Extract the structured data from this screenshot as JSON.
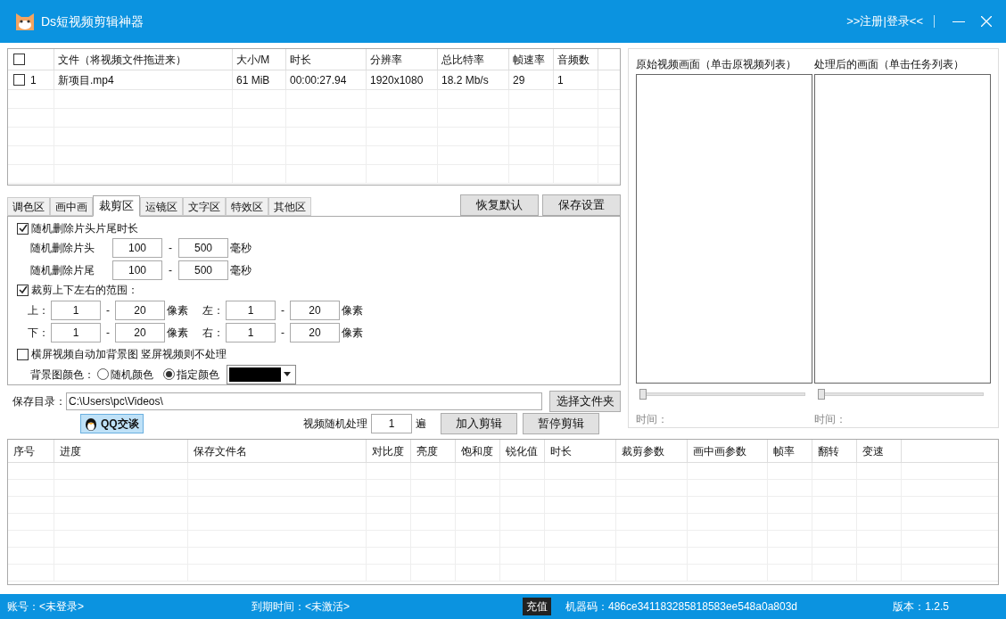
{
  "window": {
    "title": "Ds短视频剪辑神器",
    "register_link": ">>注册|登录<<"
  },
  "source_table": {
    "columns": [
      "文件（将视频文件拖进来）",
      "大小/M",
      "时长",
      "分辨率",
      "总比特率",
      "帧速率",
      "音频数"
    ],
    "header_checked": false,
    "rows": [
      {
        "checked": false,
        "index": "1",
        "cells": [
          "新项目.mp4",
          "61 MiB",
          "00:00:27.94",
          "1920x1080",
          "18.2 Mb/s",
          "29",
          "1"
        ]
      }
    ]
  },
  "tabs": [
    {
      "label": "调色区",
      "selected": false
    },
    {
      "label": "画中画",
      "selected": false
    },
    {
      "label": "裁剪区",
      "selected": true
    },
    {
      "label": "运镜区",
      "selected": false
    },
    {
      "label": "文字区",
      "selected": false
    },
    {
      "label": "特效区",
      "selected": false
    },
    {
      "label": "其他区",
      "selected": false
    }
  ],
  "tab_buttons": [
    "恢复默认",
    "保存设置"
  ],
  "trim": {
    "label": "随机删除片头片尾时长",
    "checked": true,
    "rows": [
      {
        "label": "随机删除片头",
        "from": "100",
        "separator": "-",
        "to": "500",
        "unit": "毫秒"
      },
      {
        "label": "随机删除片尾",
        "from": "100",
        "separator": "-",
        "to": "500",
        "unit": "毫秒"
      }
    ]
  },
  "crop": {
    "label": "裁剪上下左右的范围：",
    "checked": true,
    "rows": [
      [
        {
          "label": "上：",
          "from": "1",
          "separator": "-",
          "to": "20",
          "unit": "像素"
        },
        {
          "label": "左：",
          "from": "1",
          "separator": "-",
          "to": "20",
          "unit": "像素"
        }
      ],
      [
        {
          "label": "下：",
          "from": "1",
          "separator": "-",
          "to": "20",
          "unit": "像素"
        },
        {
          "label": "右：",
          "from": "1",
          "separator": "-",
          "to": "20",
          "unit": "像素"
        }
      ]
    ]
  },
  "background": {
    "label": "横屏视频自动加背景图 竖屏视频则不处理",
    "checked": false,
    "color_label": "背景图颜色：",
    "options": [
      {
        "label": "随机颜色",
        "selected": false
      },
      {
        "label": "指定颜色",
        "selected": true
      }
    ]
  },
  "save_dir": {
    "label": "保存目录：",
    "value": "C:\\Users\\pc\\Videos\\",
    "button": "选择文件夹"
  },
  "qq_button": "QQ交谈",
  "random_process": {
    "label": "视频随机处理",
    "value": "1",
    "unit": "遍"
  },
  "action_buttons": [
    "加入剪辑",
    "暂停剪辑"
  ],
  "previews": [
    {
      "title": "原始视频画面（单击原视频列表）",
      "time_label": "时间：",
      "level": 0
    },
    {
      "title": "处理后的画面（单击任务列表）",
      "time_label": "时间：",
      "level": 0
    }
  ],
  "task_table": {
    "columns": [
      "序号",
      "进度",
      "保存文件名",
      "对比度",
      "亮度",
      "饱和度",
      "锐化值",
      "时长",
      "裁剪参数",
      "画中画参数",
      "帧率",
      "翻转",
      "变速"
    ]
  },
  "status_bar": {
    "account": "账号：<未登录>",
    "expiry": "到期时间：<未激活>",
    "recharge": "充值",
    "machine_code": "机器码：486ce341183285818583ee548a0a803d",
    "version": "版本：1.2.5"
  }
}
